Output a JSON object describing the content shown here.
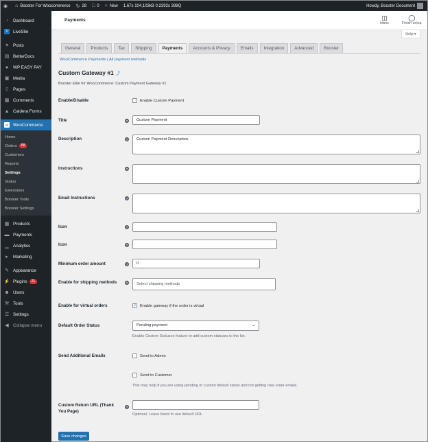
{
  "adminbar": {
    "site_name": "Booster For Woocommerce",
    "updates": "28",
    "comments": "0",
    "new_label": "New",
    "stats": [
      "1.67s",
      "104,103kB",
      "0.2392s",
      "398Q"
    ],
    "howdy": "Howdy, Booster Document"
  },
  "sidebar": {
    "items_top": [
      {
        "label": "Dashboard",
        "icon": "dashboard-icon"
      },
      {
        "label": "LiveSite",
        "icon": "livesite-icon"
      }
    ],
    "items_mid": [
      {
        "label": "Posts",
        "icon": "pin-icon"
      },
      {
        "label": "BetterDocs",
        "icon": "docs-icon"
      },
      {
        "label": "WP EASY PAY",
        "icon": "pay-icon"
      },
      {
        "label": "Media",
        "icon": "media-icon"
      },
      {
        "label": "Pages",
        "icon": "pages-icon"
      },
      {
        "label": "Comments",
        "icon": "comments-icon"
      },
      {
        "label": "Caldera Forms",
        "icon": "caldera-icon"
      }
    ],
    "woocommerce_label": "WooCommerce",
    "submenu": [
      {
        "label": "Home"
      },
      {
        "label": "Orders",
        "badge": "58"
      },
      {
        "label": "Customers"
      },
      {
        "label": "Reports"
      },
      {
        "label": "Settings",
        "active": true
      },
      {
        "label": "Status"
      },
      {
        "label": "Extensions"
      },
      {
        "label": "Booster Tools"
      },
      {
        "label": "Booster Settings"
      }
    ],
    "items_bottom": [
      {
        "label": "Products",
        "icon": "products-icon"
      },
      {
        "label": "Payments",
        "icon": "payments-icon"
      },
      {
        "label": "Analytics",
        "icon": "analytics-icon"
      },
      {
        "label": "Marketing",
        "icon": "marketing-icon"
      }
    ],
    "items_end": [
      {
        "label": "Appearance",
        "icon": "appearance-icon"
      },
      {
        "label": "Plugins",
        "icon": "plugins-icon",
        "badge": "21"
      },
      {
        "label": "Users",
        "icon": "users-icon"
      },
      {
        "label": "Tools",
        "icon": "tools-icon"
      },
      {
        "label": "Settings",
        "icon": "settings-icon"
      },
      {
        "label": "Collapse menu",
        "icon": "collapse-icon"
      }
    ]
  },
  "header": {
    "title": "Payments",
    "inbox": "Inbox",
    "finish_setup": "Finish setup",
    "help": "Help"
  },
  "tabs": [
    "General",
    "Products",
    "Tax",
    "Shipping",
    "Payments",
    "Accounts & Privacy",
    "Emails",
    "Integration",
    "Advanced",
    "Booster"
  ],
  "active_tab": "Payments",
  "subsub": {
    "link1": "WooCommerce Payments",
    "sep": " | ",
    "link2": "All payment methods"
  },
  "section": {
    "title": "Custom Gateway #1",
    "edit_icon": "⤴",
    "description": "Booster Elite for WooCommerce: Custom Payment Gateway #1"
  },
  "form": {
    "enable_label": "Enable/Disable",
    "enable_text": "Enable Custom Payment",
    "title_label": "Title",
    "title_value": "Custom Payment",
    "description_label": "Description",
    "description_value": "Custom Payment Description.",
    "instructions_label": "Instructions",
    "instructions_value": "",
    "email_instructions_label": "Email Instructions",
    "email_instructions_value": "",
    "icon_label_1": "Icon",
    "icon_value_1": "",
    "icon_label_2": "Icon",
    "icon_value_2": "",
    "min_order_label": "Minimum order amount",
    "min_order_value": "0",
    "shipping_methods_label": "Enable for shipping methods",
    "shipping_methods_placeholder": "Select shipping methods",
    "virtual_label": "Enable for virtual orders",
    "virtual_text": "Enable gateway if the order is virtual",
    "virtual_checked": "✓",
    "default_status_label": "Default Order Status",
    "default_status_value": "Pending payment",
    "default_status_desc": "Enable Custom Statuses feature to add custom statuses to the list.",
    "send_emails_label": "Send Additional Emails",
    "send_admin": "Send to Admin",
    "send_customer": "Send to Customer",
    "send_desc": "This may help if you are using pending or custom default status and not getting new order emails.",
    "return_url_label": "Custom Return URL (Thank You Page)",
    "return_url_value": "",
    "return_url_desc": "Optional. Leave blank to use default URL.",
    "save_button": "Save changes"
  }
}
